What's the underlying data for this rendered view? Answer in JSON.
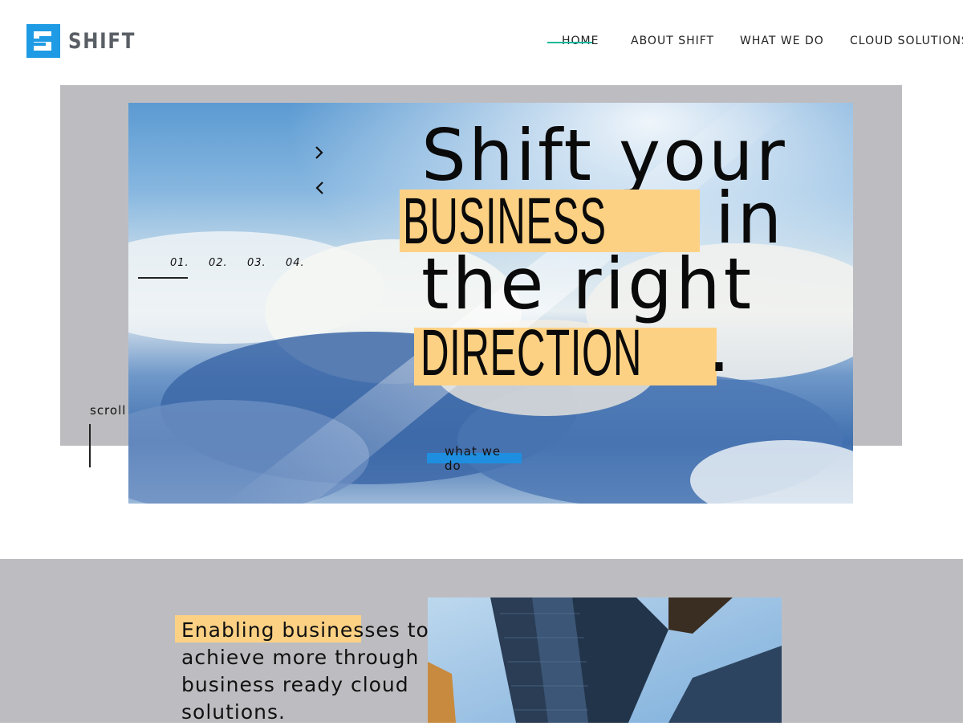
{
  "brand": {
    "name": "SHIFT",
    "logo_icon": "s-block-logo-icon",
    "accent": "#1e9be4"
  },
  "nav": {
    "items": [
      {
        "label": "HOME",
        "active": true
      },
      {
        "label": "ABOUT SHIFT"
      },
      {
        "label": "WHAT WE DO"
      },
      {
        "label": "CLOUD SOLUTIONS"
      }
    ],
    "active_marker_color": "#1fb89c"
  },
  "hero": {
    "headline": {
      "line1": "Shift your",
      "line2_highlight": "BUSINESS",
      "line2_rest": "in",
      "line3": "the right",
      "line4_highlight": "DIRECTION",
      "line4_rest": "."
    },
    "highlight_color": "#fdd184",
    "slides": [
      "01.",
      "02.",
      "03.",
      "04."
    ],
    "active_slide": 0,
    "arrows": {
      "next": "chevron-right-icon",
      "prev": "chevron-left-icon"
    },
    "cta_label": "what we do",
    "cta_color": "#1e8fe0",
    "scroll_label": "scroll"
  },
  "section2": {
    "tagline_highlight": "Enabling busines",
    "tagline": "Enabling businesses to\nachieve more through\nbusiness ready cloud\nsolutions."
  }
}
